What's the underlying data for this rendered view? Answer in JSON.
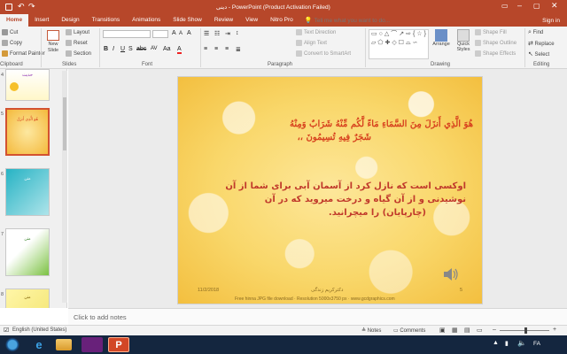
{
  "title_bar": {
    "title": "دینی - PowerPoint (Product Activation Failed)"
  },
  "tabs": [
    {
      "label": "Home",
      "active": true
    },
    {
      "label": "Insert"
    },
    {
      "label": "Design"
    },
    {
      "label": "Transitions"
    },
    {
      "label": "Animations"
    },
    {
      "label": "Slide Show"
    },
    {
      "label": "Review"
    },
    {
      "label": "View"
    },
    {
      "label": "Nitro Pro"
    }
  ],
  "tell_me": {
    "placeholder": "Tell me what you want to do..."
  },
  "sign_in": "Sign in",
  "ribbon": {
    "clipboard": {
      "cut": "Cut",
      "copy": "Copy",
      "format_painter": "Format Painter",
      "label": "Clipboard"
    },
    "slides": {
      "new_slide": "New Slide",
      "layout": "Layout",
      "reset": "Reset",
      "section": "Section",
      "label": "Slides"
    },
    "font": {
      "label": "Font"
    },
    "paragraph": {
      "text_direction": "Text Direction",
      "align_text": "Align Text",
      "convert_smartart": "Convert to SmartArt",
      "label": "Paragraph"
    },
    "drawing": {
      "arrange": "Arrange",
      "quick_styles": "Quick Styles",
      "shape_fill": "Shape Fill",
      "shape_outline": "Shape Outline",
      "shape_effects": "Shape Effects",
      "label": "Drawing"
    },
    "editing": {
      "find": "Find",
      "replace": "Replace",
      "select": "Select",
      "label": "Editing"
    }
  },
  "thumbnails": [
    {
      "number": "4",
      "text": "حدیث"
    },
    {
      "number": "5",
      "text": "هُوَ الَّذِي أَنزَلَ"
    },
    {
      "number": "6",
      "text": "متن"
    },
    {
      "number": "7",
      "text": "متن"
    },
    {
      "number": "8",
      "text": "متن"
    }
  ],
  "slide": {
    "arabic_line1": "هُوَ الَّذِي أَنزَلَ مِنَ السَّمَاءِ مَاءً لَّكُم مِّنْهُ شَرَابٌ وَمِنْهُ",
    "arabic_line2": "شَجَرٌ فِيهِ تُسِيمُونَ ،،",
    "persian_line1": "اوکسی است که نازل کرد از آسمان آبی برای شما از آن",
    "persian_line2": "نوشیدنی و از آن گیاه و درخت میروید که در آن",
    "persian_line3": "(چارپایان) را میچرانید.",
    "date": "11/2/2018",
    "footer": "دکترکریم زندگی",
    "number": "5",
    "credit": "Free hinna JPG file download  ·  Resolution 5000x3750 px  ·  www.gcdgraphics.com"
  },
  "notes_placeholder": "Click to add notes",
  "status": {
    "language": "English (United States)",
    "notes": "Notes",
    "comments": "Comments"
  },
  "taskbar": {
    "lang": "FA"
  }
}
